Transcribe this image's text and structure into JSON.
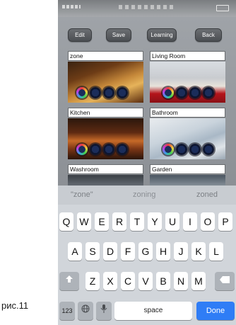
{
  "caption": "рис.11",
  "toolbar": {
    "edit_label": "Edit",
    "save_label": "Save",
    "learning_label": "Learning",
    "back_label": "Back"
  },
  "zones": [
    {
      "label": "zone"
    },
    {
      "label": "Living Room"
    },
    {
      "label": "Kitchen"
    },
    {
      "label": "Bathroom"
    },
    {
      "label": "Washroom"
    },
    {
      "label": "Garden"
    }
  ],
  "keyboard": {
    "suggestions": [
      "\"zone\"",
      "zoning",
      "zoned"
    ],
    "row1": [
      "Q",
      "W",
      "E",
      "R",
      "T",
      "Y",
      "U",
      "I",
      "O",
      "P"
    ],
    "row2": [
      "A",
      "S",
      "D",
      "F",
      "G",
      "H",
      "J",
      "K",
      "L"
    ],
    "row3": [
      "Z",
      "X",
      "C",
      "V",
      "B",
      "N",
      "M"
    ],
    "numbers_label": "123",
    "space_label": "space",
    "done_label": "Done"
  },
  "colors": {
    "done_key": "#2f7df6",
    "toolbar_button": "#5a5d61"
  }
}
